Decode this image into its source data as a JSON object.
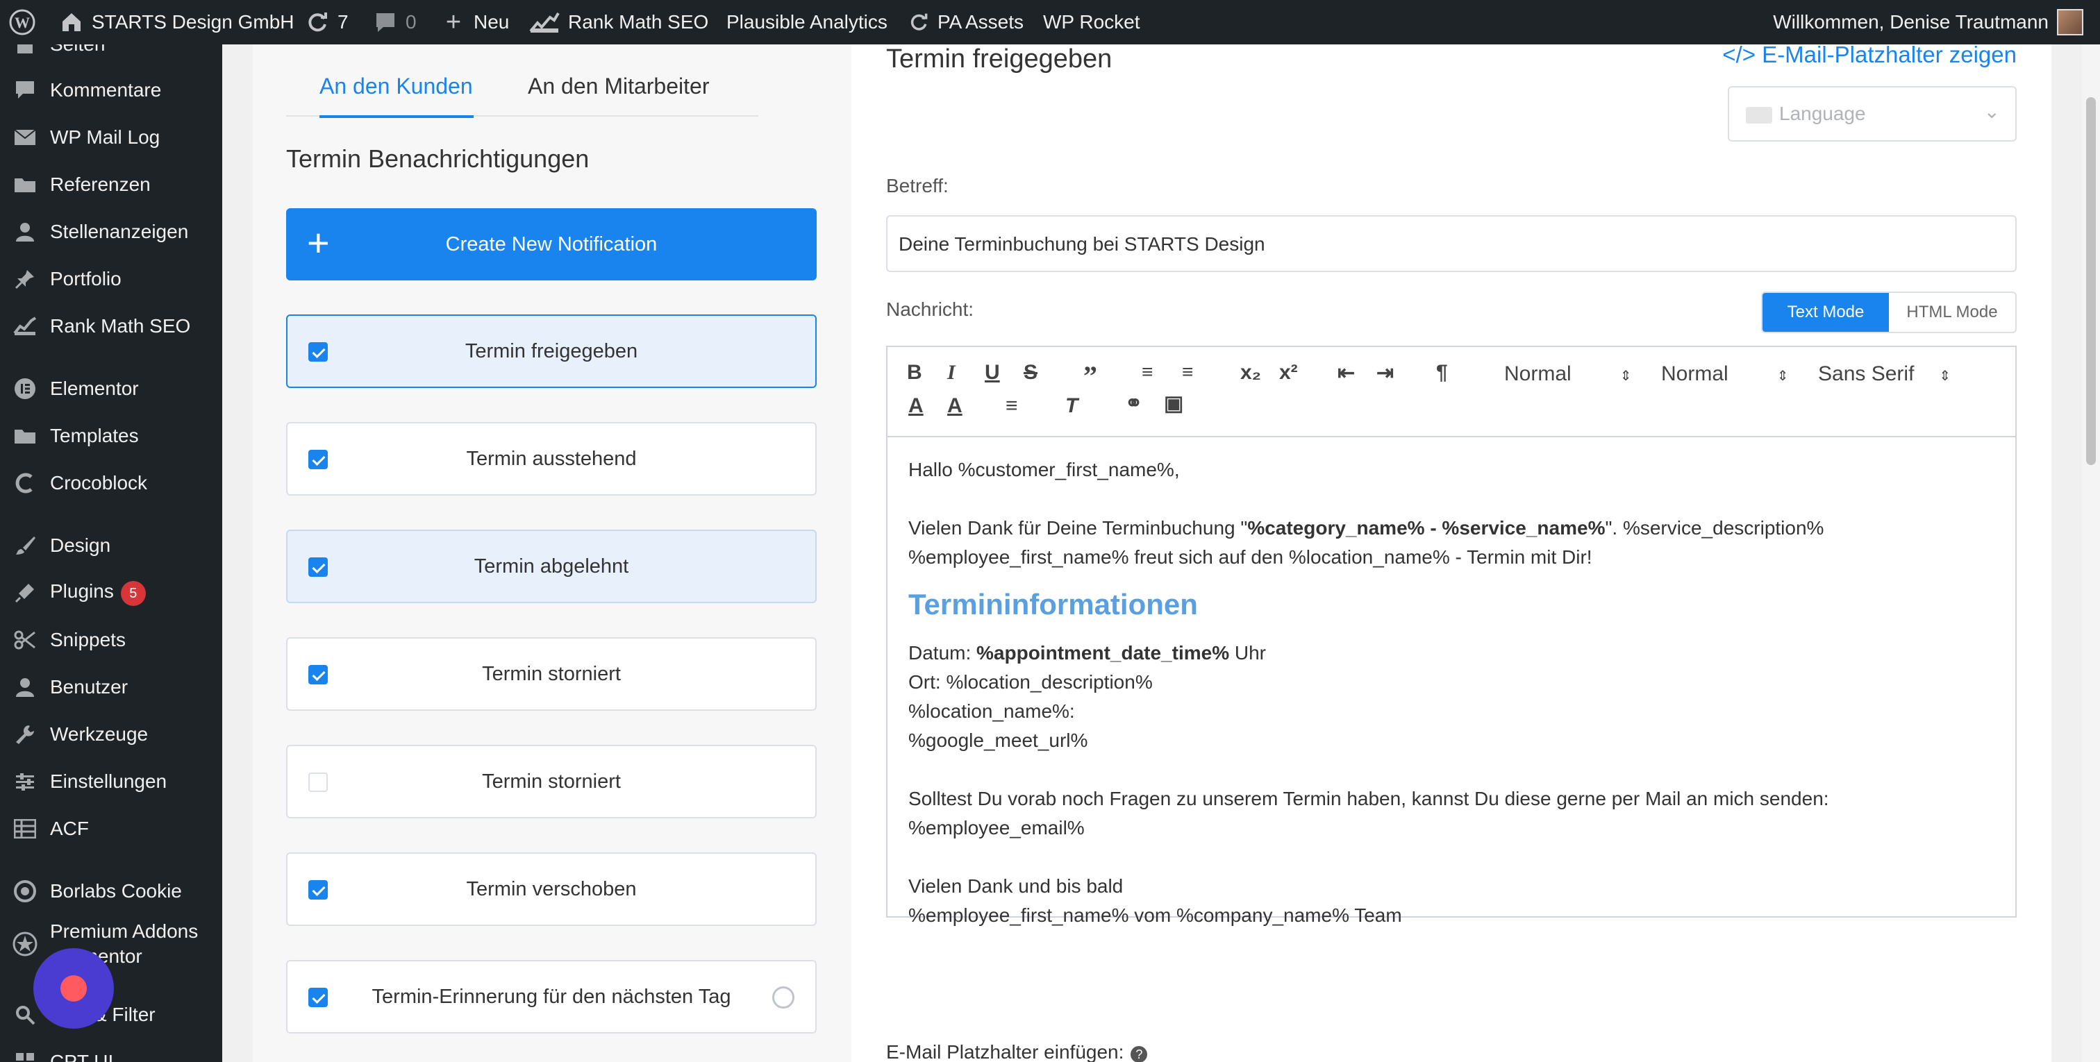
{
  "adminbar": {
    "site_name": "STARTS Design GmbH",
    "updates_count": "7",
    "comments_count": "0",
    "new_label": "Neu",
    "rank_math": "Rank Math SEO",
    "plausible": "Plausible Analytics",
    "pa_assets": "PA Assets",
    "wp_rocket": "WP Rocket",
    "greeting": "Willkommen, Denise Trautmann"
  },
  "sidebar": {
    "items": [
      {
        "label": "Seiten",
        "icon": "pages-icon"
      },
      {
        "label": "Kommentare",
        "icon": "comments-icon"
      },
      {
        "label": "WP Mail Log",
        "icon": "mail-icon"
      },
      {
        "label": "Referenzen",
        "icon": "folder-icon"
      },
      {
        "label": "Stellenanzeigen",
        "icon": "user-icon"
      },
      {
        "label": "Portfolio",
        "icon": "pin-icon"
      },
      {
        "label": "Rank Math SEO",
        "icon": "chart-icon"
      },
      {
        "label": "Elementor",
        "icon": "elementor-icon"
      },
      {
        "label": "Templates",
        "icon": "folder-icon"
      },
      {
        "label": "Crocoblock",
        "icon": "crocoblock-icon"
      },
      {
        "label": "Design",
        "icon": "brush-icon"
      },
      {
        "label": "Plugins",
        "icon": "plugin-icon",
        "badge": "5"
      },
      {
        "label": "Snippets",
        "icon": "scissors-icon"
      },
      {
        "label": "Benutzer",
        "icon": "user-icon"
      },
      {
        "label": "Werkzeuge",
        "icon": "wrench-icon"
      },
      {
        "label": "Einstellungen",
        "icon": "settings-icon"
      },
      {
        "label": "ACF",
        "icon": "grid-icon"
      },
      {
        "label": "Borlabs Cookie",
        "icon": "cookie-icon"
      },
      {
        "label": "Premium Addons",
        "icon": "star-icon"
      },
      {
        "label": "ementor",
        "icon": "star-icon"
      },
      {
        "label": "en & Filter",
        "icon": "search-icon"
      },
      {
        "label": "CPT UI",
        "icon": "grid-icon"
      }
    ]
  },
  "left": {
    "tabs": [
      "An den Kunden",
      "An den Mitarbeiter"
    ],
    "section_title": "Termin Benachrichtigungen",
    "create_button": "Create New Notification",
    "notifications": [
      {
        "label": "Termin freigegeben",
        "checked": true
      },
      {
        "label": "Termin ausstehend",
        "checked": true
      },
      {
        "label": "Termin abgelehnt",
        "checked": true
      },
      {
        "label": "Termin storniert",
        "checked": true
      },
      {
        "label": "Termin storniert",
        "checked": false
      },
      {
        "label": "Termin verschoben",
        "checked": true
      },
      {
        "label": "Termin-Erinnerung für den nächsten Tag",
        "checked": true
      }
    ]
  },
  "right": {
    "title": "Termin freigegeben",
    "placeholder_link": "</> E-Mail-Platzhalter zeigen",
    "language_placeholder": "Language",
    "subject_label": "Betreff:",
    "subject_value": "Deine Terminbuchung bei STARTS Design",
    "message_label": "Nachricht:",
    "mode_text": "Text Mode",
    "mode_html": "HTML Mode",
    "toolbar": {
      "header_select": "Normal",
      "size_select": "Normal",
      "font_select": "Sans Serif"
    },
    "body": {
      "greeting": "Hallo %customer_first_name%,",
      "thanks_prefix": "Vielen Dank für Deine Terminbuchung \"",
      "thanks_bold": "%category_name% - %service_name%",
      "thanks_suffix": "\". %service_description%",
      "employee_line": "%employee_first_name% freut sich auf den %location_name% - Termin mit Dir!",
      "heading": "Termininformationen",
      "date_prefix": "Datum: ",
      "date_bold": "%appointment_date_time%",
      "date_suffix": " Uhr",
      "location_line": "Ort: %location_description%",
      "location_name_line": "%location_name%:",
      "meet_line": "%google_meet_url%",
      "question_line": "Solltest Du vorab noch Fragen zu unserem Termin haben, kannst Du diese gerne per Mail an mich senden:",
      "email_line": "%employee_email%",
      "closing_line": "Vielen Dank und bis bald",
      "signature_line": "%employee_first_name% vom %company_name% Team"
    },
    "insert_label": "E-Mail Platzhalter einfügen:"
  }
}
